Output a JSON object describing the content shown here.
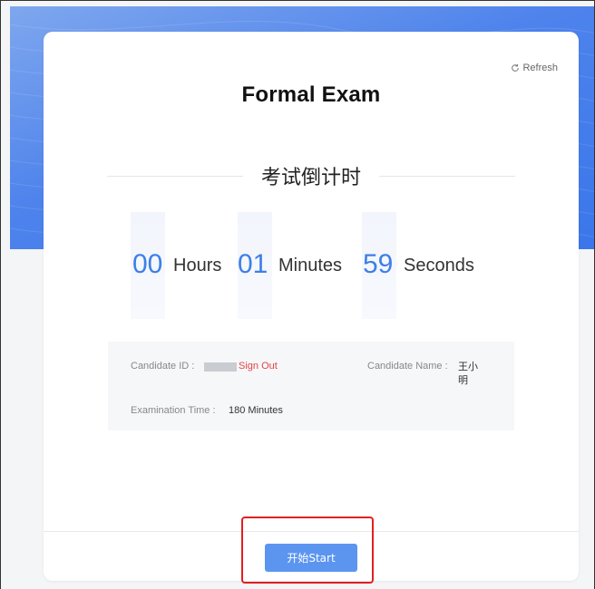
{
  "header": {
    "refresh_label": "Refresh",
    "exam_title": "Formal Exam"
  },
  "countdown": {
    "heading": "考试倒计时",
    "hours_value": "00",
    "hours_label": "Hours",
    "minutes_value": "01",
    "minutes_label": "Minutes",
    "seconds_value": "59",
    "seconds_label": "Seconds"
  },
  "candidate": {
    "id_label": "Candidate ID :",
    "sign_out_label": "Sign Out",
    "name_label": "Candidate Name :",
    "name_value": "王小明",
    "time_label": "Examination Time :",
    "time_value": "180 Minutes"
  },
  "actions": {
    "start_label": "开始Start"
  },
  "colors": {
    "accent_blue": "#3d7fe8",
    "button_blue": "#5b95f0",
    "sign_out_red": "#e54545",
    "highlight_red": "#e0201f"
  },
  "icons": {
    "refresh": "refresh-icon"
  }
}
